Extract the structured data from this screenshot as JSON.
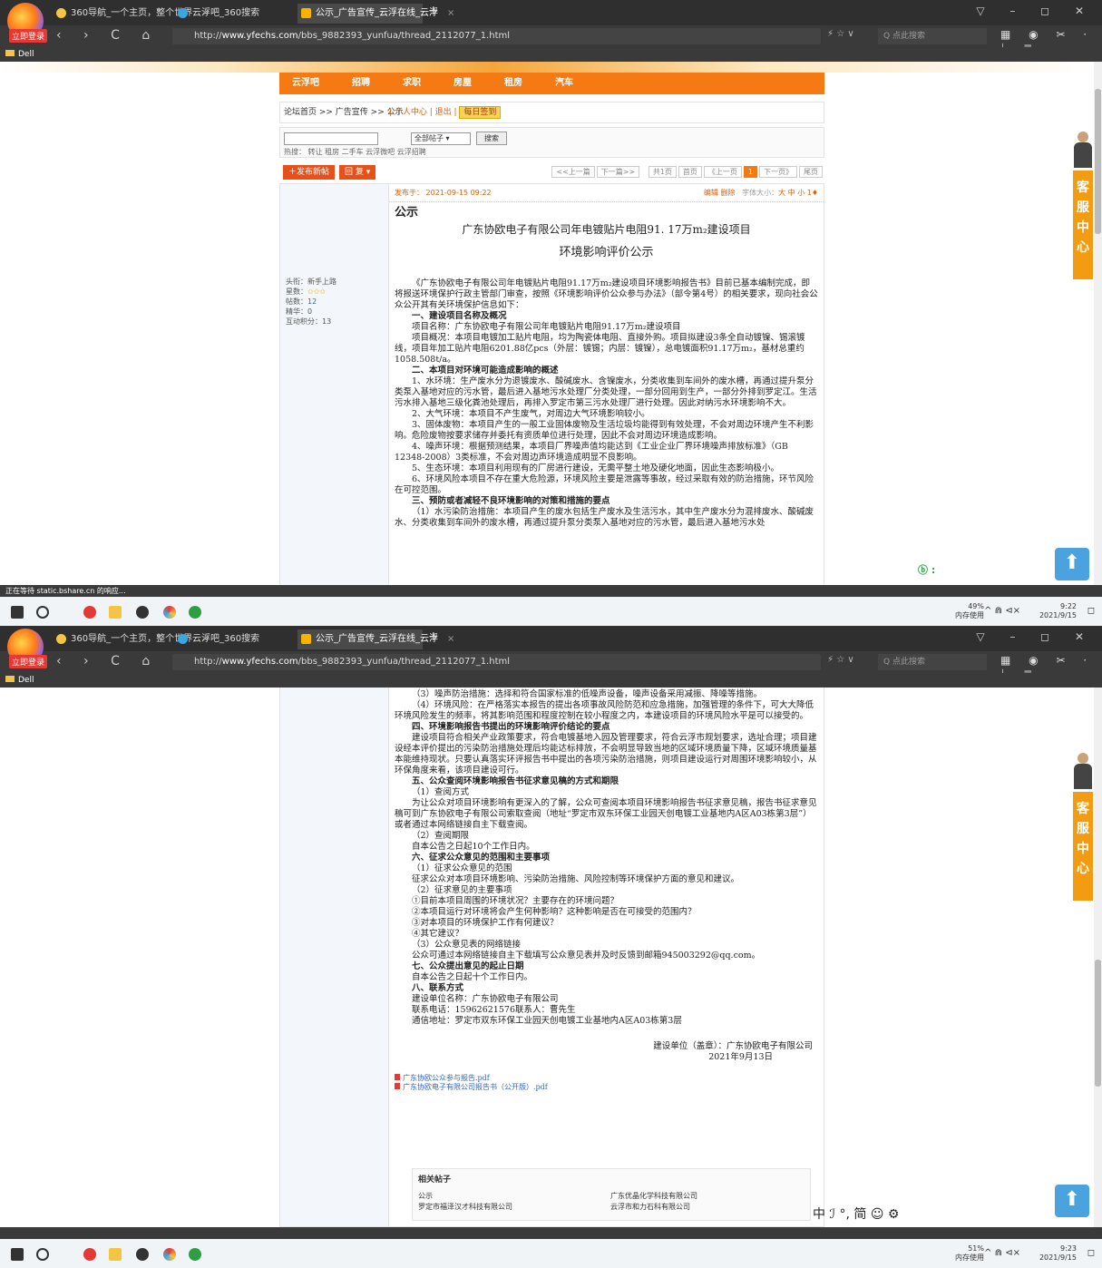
{
  "browser": {
    "login_label": "立即登录",
    "tabs": [
      {
        "label": "360导航_一个主页，整个世界",
        "close": "×"
      },
      {
        "label": "云浮吧_360搜索",
        "close": "×"
      },
      {
        "label": "公示_广告宣传_云浮在线_云浮",
        "close": "×"
      }
    ],
    "newtab": "+",
    "window_controls": "▽ – ◻ ✕",
    "nav_buttons": "‹ › C ⌂ ⟲ ☆",
    "url_prefix": "http://",
    "url_domain": "www.yfechs.com",
    "url_path": "/bbs_9882393_yunfua/thread_2112077_1.html",
    "url_icons": "⚡ ☆ ∨",
    "search_placeholder": "Q 点此搜索",
    "toolbar_icons": "▦ ◉ ✂ · ⤓ ≡",
    "bookmark": "Dell"
  },
  "forum": {
    "nav": [
      "云浮吧",
      "招聘",
      "求职",
      "房屋",
      "租房",
      "汽车"
    ],
    "breadcrumb": "论坛首页 >> 广告宣传 >> 公示",
    "user_links": "| 个人中心 | 退出 |",
    "sign_in": "每日签到",
    "search_select": "全部帖子 ▾",
    "search_button": "搜索",
    "hot_label": "热搜：",
    "hot_tags": "转让  租房  二手车  云浮微吧  云浮招聘",
    "new_post": "＋发布新帖",
    "reply": "回 复 ▾",
    "pager_prev_next": [
      "<<上一篇",
      "下一篇>>"
    ],
    "pager": [
      "共1页",
      "首页",
      "《上一页",
      "1",
      "下一页》",
      "尾页"
    ],
    "post_date": "发布于：  2021-09-15 09:22",
    "post_ops": "编辑  删除",
    "font_size_label": "字体大小：",
    "font_size_opts": "大  中  小  1♦",
    "user": {
      "title": "头衔：新手上路",
      "level": "星数：",
      "level_stars": "✩✩✩",
      "posts": "帖数：",
      "posts_val": "12",
      "essence": "精华：0",
      "points": "互动积分：13"
    },
    "label_gs": "公示",
    "title1": "广东协欧电子有限公司年电镀贴片电阻91. 17万m₂建设项目",
    "title2": "环境影响评价公示",
    "p1": "《广东协欧电子有限公司年电镀贴片电阻91.17万m₂建设项目环境影响报告书》目前已基本编制完成，即将报送环境保护行政主管部门审查，按照《环境影响评价公众参与办法》（部令第4号）的相关要求，现向社会公众公开其有关环境保护信息如下：",
    "h1": "一、建设项目名称及概况",
    "p2": "项目名称：广东协欧电子有限公司年电镀贴片电阻91.17万m₂建设项目",
    "p3": "项目概况：本项目电镀加工贴片电阻，均为陶瓷体电阻、直接外购。项目拟建设3条全自动镀镍、锡滚镀线，项目年加工贴片电阻6201.88亿pcs（外层：镀锡；内层：镀镍），总电镀面积91.17万m₂，基材总重约1058.508t/a。",
    "h2": "二、本项目对环境可能造成影响的概述",
    "p4": "1、水环境：生产废水分为退镀废水、酸碱废水、含镍废水，分类收集到车间外的废水槽，再通过提升泵分类泵入基地对应的污水管，最后进入基地污水处理厂分类处理，一部分回用到生产，一部分外排到罗定江。生活污水排入基地三级化粪池处理后，再排入罗定市第三污水处理厂进行处理。因此对纳污水环境影响不大。",
    "p5": "2、大气环境：本项目不产生废气，对周边大气环境影响较小。",
    "p6": "3、固体废物：本项目产生的一般工业固体废物及生活垃圾均能得到有效处理，不会对周边环境产生不利影响。危险废物按要求储存并委托有资质单位进行处理，因此不会对周边环境造成影响。",
    "p7": "4、噪声环境：根据预测结果，本项目厂界噪声值均能达到《工业企业厂界环境噪声排放标准》（GB 12348-2008）3类标准，不会对周边声环境造成明显不良影响。",
    "p8": "5、生态环境：本项目利用现有的厂房进行建设，无需平整土地及硬化地面，因此生态影响极小。",
    "p9": "6、环境风险本项目不存在重大危险源，环境风险主要是泄露等事故，经过采取有效的防治措施，环节风险在可控范围。",
    "h3": "三、预防或者减轻不良环境影响的对策和措施的要点",
    "p10": "（1）水污染防治措施：本项目产生的废水包括生产废水及生活污水，其中生产废水分为混排废水、酸碱废水、分类收集到车间外的废水槽，再通过提升泵分类泵入基地对应的污水管，最后进入基地污水处",
    "s2_p1": "（3）噪声防治措施：选择和符合国家标准的低噪声设备，噪声设备采用减振、降噪等措施。",
    "s2_p2": "（4）环境风险：在严格落实本报告的提出各项事故风险防范和应急措施，加强管理的条件下，可大大降低环境风险发生的频率，将其影响范围和程度控制在较小程度之内，本建设项目的环境风险水平是可以接受的。",
    "s2_h4": "四、环境影响报告书提出的环境影响评价结论的要点",
    "s2_p3": "建设项目符合相关产业政策要求，符合电镀基地入园及管理要求，符合云浮市规划要求，选址合理；项目建设经本评价提出的污染防治措施处理后均能达标排放，不会明显导致当地的区域环境质量下降，区域环境质量基本能维持现状。只要认真落实环评报告书中提出的各项污染防治措施，则项目建设运行对周围环境影响较小，从环保角度来看，该项目建设可行。",
    "s2_h5": "五、公众查阅环境影响报告书征求意见稿的方式和期限",
    "s2_l1": "（1）查阅方式",
    "s2_p4": "为让公众对项目环境影响有更深入的了解，公众可查阅本项目环境影响报告书征求意见稿，报告书征求意见稿可到广东协欧电子有限公司索取查阅（地址“罗定市双东环保工业园天创电镀工业基地内A区A03栋第3层”）或者通过本网络链接自主下载查阅。",
    "s2_l2": "（2）查阅期限",
    "s2_p5": "自本公告之日起10个工作日内。",
    "s2_h6": "六、征求公众意见的范围和主要事项",
    "s2_l3": "（1）征求公众意见的范围",
    "s2_p6": "征求公众对本项目环境影响、污染防治措施、风险控制等环境保护方面的意见和建议。",
    "s2_l4": "（2）征求意见的主要事项",
    "s2_q1": "①目前本项目周围的环境状况？主要存在的环境问题？",
    "s2_q2": "②本项目运行对环境将会产生何种影响？这种影响是否在可接受的范围内？",
    "s2_q3": "③对本项目的环境保护工作有何建议？",
    "s2_q4": "④其它建议？",
    "s2_l5": "（3）公众意见表的网络链接",
    "s2_p7": "公众可通过本网络链接自主下载填写公众意见表并及时反馈到邮箱945003292@qq.com。",
    "s2_h7": "七、公众提出意见的起止日期",
    "s2_p8": "自本公告之日起十个工作日内。",
    "s2_h8": "八、联系方式",
    "s2_c1": "建设单位名称：广东协欧电子有限公司",
    "s2_c2": "联系电话：15962621576联系人：曹先生",
    "s2_c3": "通信地址：罗定市双东环保工业园天创电镀工业基地内A区A03栋第3层",
    "s2_sig1": "建设单位（盖章）：广东协欧电子有限公司",
    "s2_sig2": "2021年9月13日",
    "att1": "广东协欧公众参与报告.pdf",
    "att2": "广东协欧电子有限公司报告书（公开版）.pdf",
    "rel_title": "相关帖子",
    "rel_items": [
      "公示",
      "罗定市福泽汉才科技有限公司"
    ],
    "rel_items2": [
      "广东优晶化学科技有限公司",
      "云浮市和力石科有限公司"
    ]
  },
  "side": {
    "kefu": "客服中心",
    "totop": "⬆"
  },
  "status": {
    "loading": "正在等待 static.bshare.cn 的响应..."
  },
  "taskbar": {
    "mem1": "49%",
    "memlabel": "内存使用",
    "time1": "9:22",
    "date1": "2021/9/15",
    "mem2": "51%",
    "time2": "9:23",
    "date2": "2021/9/15",
    "tray_icons": "^ ⋒ ⊲×",
    "notif": "◻"
  },
  "ime": "中 ℐ °, 简 ☺ ⚙",
  "badge": "ⓑ :"
}
